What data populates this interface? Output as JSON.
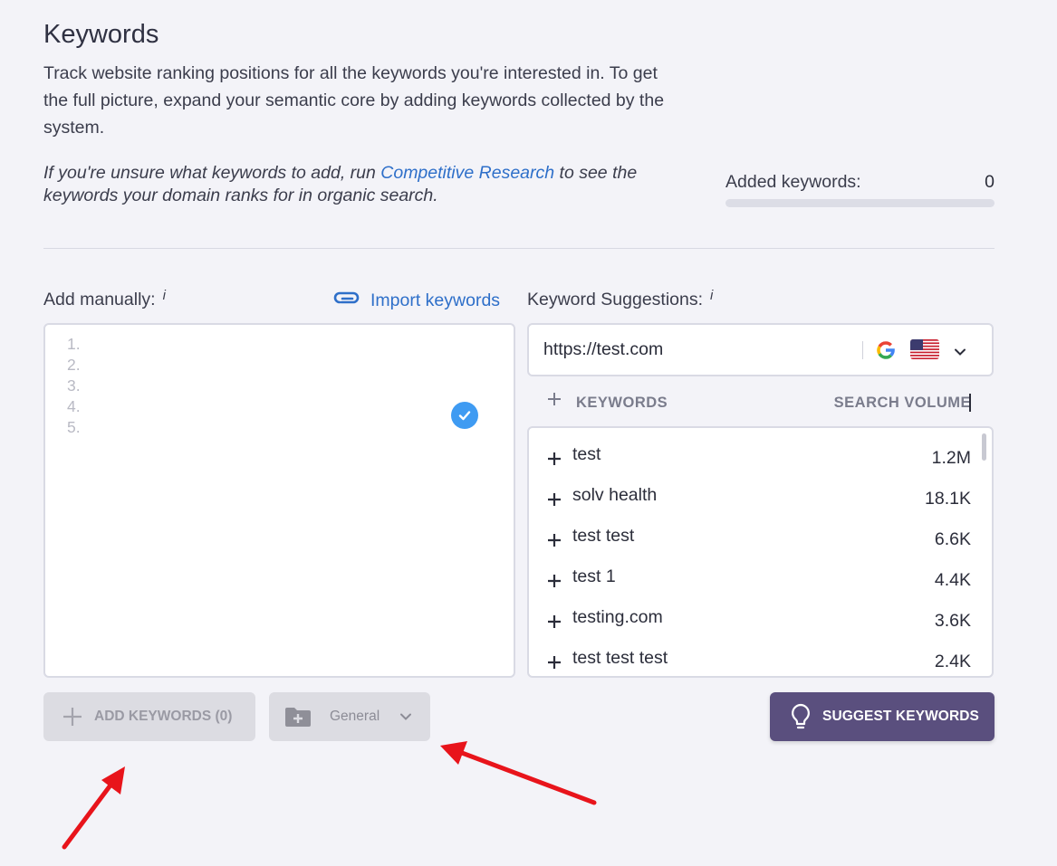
{
  "header": {
    "title": "Keywords",
    "intro": "Track website ranking positions for all the keywords you're interested in. To get the full picture, expand your semantic core by adding keywords collected by the system.",
    "hint_prefix": "If you're unsure what keywords to add, run ",
    "hint_link": "Competitive Research",
    "hint_suffix": " to see the keywords your domain ranks for in organic search."
  },
  "added": {
    "label": "Added keywords:",
    "count": "0",
    "progress": 0
  },
  "manual": {
    "label": "Add manually:",
    "info": "i",
    "import_label": "Import keywords",
    "line_numbers": [
      "1.",
      "2.",
      "3.",
      "4.",
      "5."
    ]
  },
  "suggestions": {
    "label": "Keyword Suggestions:",
    "info": "i",
    "url_value": "https://test.com",
    "search_engine_icon": "google-icon",
    "country_flag_icon": "us-flag-icon",
    "col_keywords": "KEYWORDS",
    "col_volume": "SEARCH VOLUME",
    "rows": [
      {
        "keyword": "test",
        "volume": "1.2M"
      },
      {
        "keyword": "solv health",
        "volume": "18.1K"
      },
      {
        "keyword": "test test",
        "volume": "6.6K"
      },
      {
        "keyword": "test 1",
        "volume": "4.4K"
      },
      {
        "keyword": "testing.com",
        "volume": "3.6K"
      },
      {
        "keyword": "test test test",
        "volume": "2.4K"
      }
    ]
  },
  "actions": {
    "add_label": "ADD KEYWORDS (0)",
    "group_label": "General",
    "suggest_label": "SUGGEST KEYWORDS"
  },
  "colors": {
    "background": "#f3f3f8",
    "link": "#2e6fc9",
    "primary_button": "#5a4f7e",
    "check": "#3f9bf2",
    "annotation_arrow": "#e8141b"
  }
}
